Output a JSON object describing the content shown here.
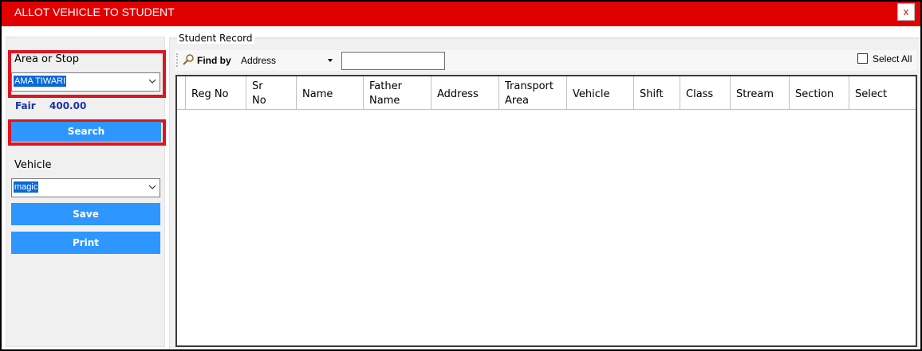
{
  "window": {
    "title": "ALLOT VEHICLE TO STUDENT",
    "close_label": "x"
  },
  "left": {
    "area_label": "Area or Stop",
    "area_value": "AMA TIWARI",
    "fair_label": "Fair",
    "fair_value": "400.00",
    "search_label": "Search",
    "vehicle_label": "Vehicle",
    "vehicle_value": "magic",
    "save_label": "Save",
    "print_label": "Print"
  },
  "records": {
    "group_label": "Student Record",
    "find_by_label": "Find by",
    "find_by_value": "Address",
    "find_value": "",
    "select_all_label": "Select All",
    "columns": [
      {
        "line1": "Reg No",
        "line2": ""
      },
      {
        "line1": "Sr",
        "line2": "No"
      },
      {
        "line1": "Name",
        "line2": ""
      },
      {
        "line1": "Father",
        "line2": "Name"
      },
      {
        "line1": "Address",
        "line2": ""
      },
      {
        "line1": "Transport",
        "line2": "Area"
      },
      {
        "line1": "Vehicle",
        "line2": ""
      },
      {
        "line1": "Shift",
        "line2": ""
      },
      {
        "line1": "Class",
        "line2": ""
      },
      {
        "line1": "Stream",
        "line2": ""
      },
      {
        "line1": "Section",
        "line2": ""
      },
      {
        "line1": "Select",
        "line2": ""
      }
    ]
  },
  "colors": {
    "title_bar": "#e00000",
    "highlight": "#dc1522",
    "button": "#2e97ff",
    "fair_text": "#1c33a8"
  }
}
